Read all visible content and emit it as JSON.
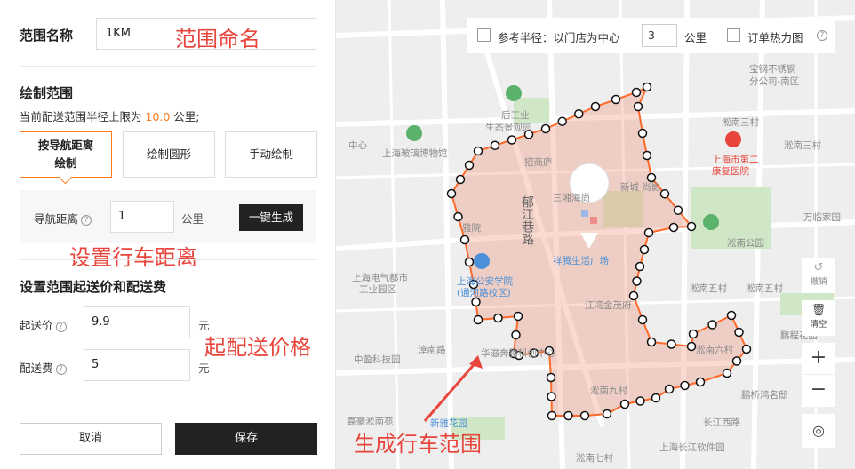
{
  "form": {
    "name_label": "范围名称",
    "name_value": "1KM",
    "draw_title": "绘制范围",
    "hint_prefix": "当前配送范围半径上限为 ",
    "hint_limit": "10.0",
    "hint_suffix": " 公里;",
    "modes": [
      {
        "label_line1": "按导航距离",
        "label_line2": "绘制",
        "active": true
      },
      {
        "label_line1": "绘制圆形",
        "label_line2": "",
        "active": false
      },
      {
        "label_line1": "手动绘制",
        "label_line2": "",
        "active": false
      }
    ],
    "nav_label": "导航距离",
    "nav_value": "1",
    "nav_unit": "公里",
    "generate_label": "一键生成",
    "fee_title": "设置范围起送价和配送费",
    "min_price_label": "起送价",
    "min_price_value": "9.9",
    "delivery_fee_label": "配送费",
    "delivery_fee_value": "5",
    "currency_unit": "元",
    "cancel_label": "取消",
    "save_label": "保存"
  },
  "annotations": {
    "name": "范围命名",
    "distance": "设置行车距离",
    "price": "起配送价格",
    "range": "生成行车范围"
  },
  "map": {
    "ref_radius_label": "参考半径：以门店为中心",
    "ref_radius_value": "3",
    "ref_radius_unit": "公里",
    "heatmap_label": "订单热力图",
    "undo_label": "撤销",
    "clear_label": "清空",
    "zoom_in": "+",
    "zoom_out": "−",
    "store_label": "祥腾生活广场",
    "labels": {
      "l1": "宝钢不锈钢",
      "l2": "分公司-南区",
      "l3": "后工业",
      "l4": "生态景观园",
      "l5": "上海玻璃博物馆",
      "l6": "淞南三村",
      "l7": "淞南三村",
      "l8": "上海市第二",
      "l9": "康复医院",
      "l10": "招商庐",
      "l11": "三湘海尚",
      "l12": "新城·尚影",
      "l13": "郁江巷路",
      "l14": "淞南公园",
      "l15": "万临家园",
      "l16": "上海电气都市",
      "l17": "工业园区",
      "l18": "上海公安学院",
      "l19": "(通河路校区)",
      "l20": "淞南五村",
      "l21": "淞南五村",
      "l22": "鹏程花园",
      "l23": "江湾金茂府",
      "l24": "淞南六村",
      "l25": "华滋奔腾科创中心",
      "l26": "中盈科技园",
      "l27": "淞南九村",
      "l28": "鹏桥鸿名邸",
      "l29": "长江西路",
      "l30": "上海长江软件园",
      "l31": "淞南七村",
      "l32": "嘉豪淞南苑",
      "l33": "新雅花园",
      "l34": "雅院",
      "l35": "中心",
      "l36": "漳南路"
    }
  }
}
